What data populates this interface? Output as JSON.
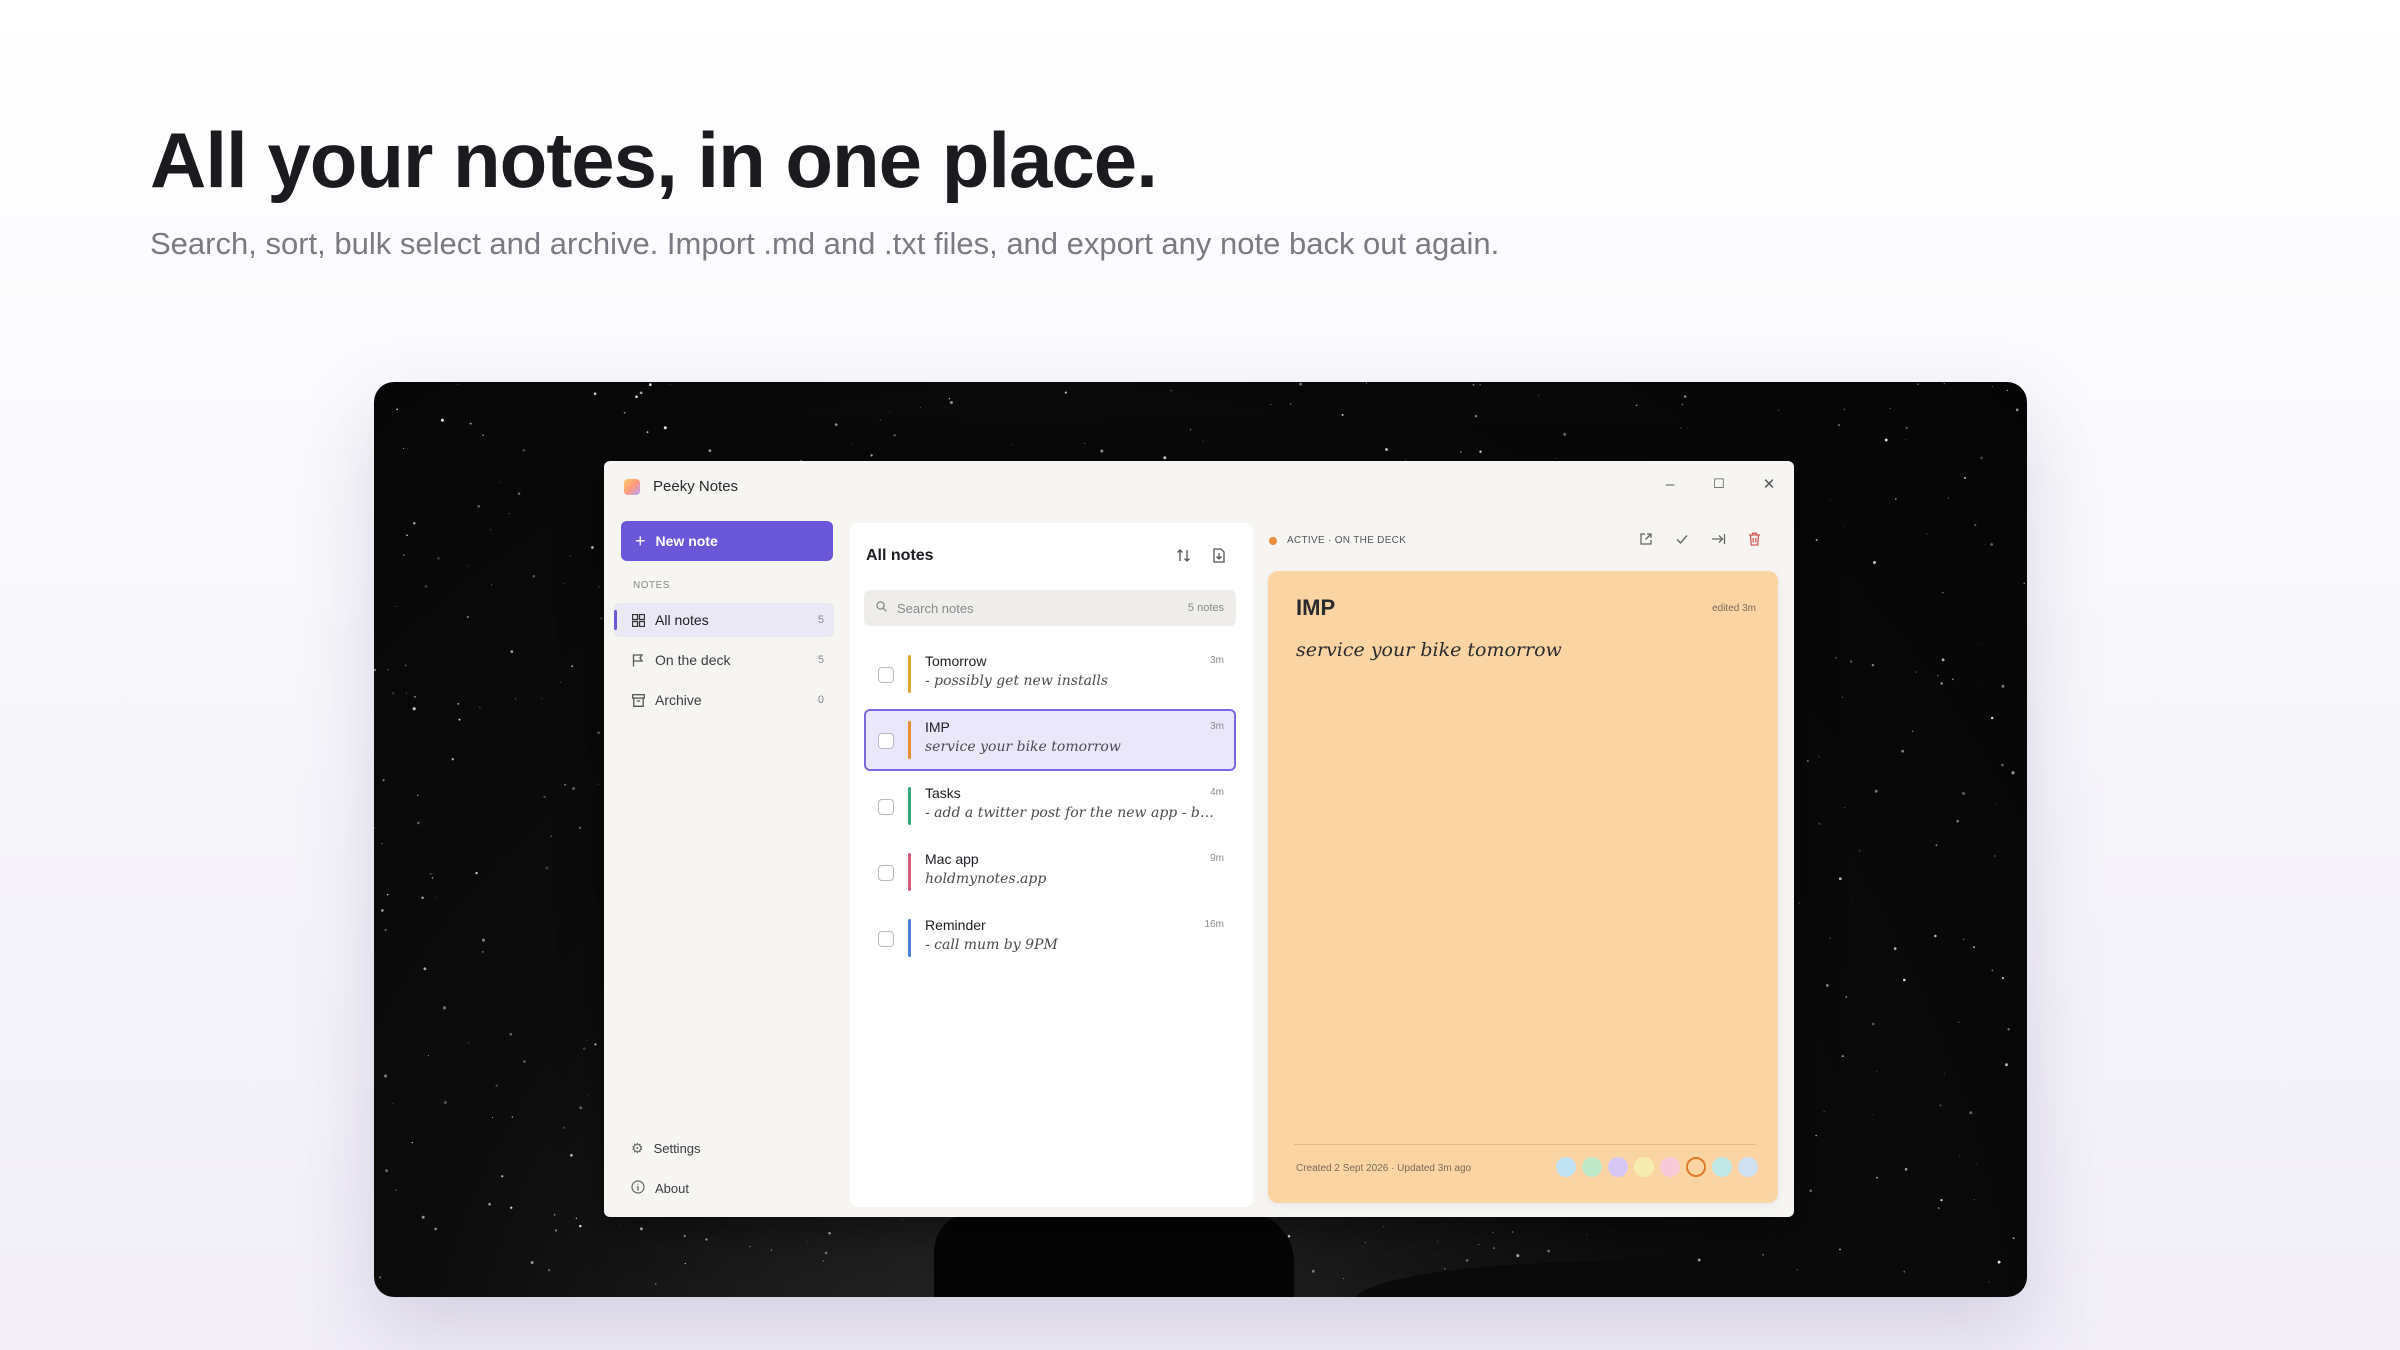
{
  "hero": {
    "title": "All your notes, in one place.",
    "subtitle": "Search, sort, bulk select and archive. Import .md and .txt files, and export any note back out again."
  },
  "app": {
    "title": "Peeky Notes",
    "window_controls": {
      "minimize": "–",
      "maximize": "☐",
      "close": "✕"
    }
  },
  "sidebar": {
    "new_note_label": "New note",
    "section_label": "NOTES",
    "items": [
      {
        "label": "All notes",
        "count": "5",
        "icon": "grid-icon"
      },
      {
        "label": "On the deck",
        "count": "5",
        "icon": "flag-icon"
      },
      {
        "label": "Archive",
        "count": "0",
        "icon": "archive-icon"
      }
    ],
    "footer": [
      {
        "label": "Settings",
        "icon": "gear-icon"
      },
      {
        "label": "About",
        "icon": "info-icon"
      }
    ]
  },
  "list": {
    "title": "All notes",
    "search_placeholder": "Search notes",
    "search_count": "5 notes",
    "notes": [
      {
        "title": "Tomorrow",
        "preview": "- possibly get new installs",
        "time": "3m",
        "color": "#e0a92e"
      },
      {
        "title": "IMP",
        "preview": "service your bike tomorrow",
        "time": "3m",
        "color": "#e98b3a"
      },
      {
        "title": "Tasks",
        "preview": "- add a twitter post for the new app - bu...",
        "time": "4m",
        "color": "#3aa57a"
      },
      {
        "title": "Mac app",
        "preview": "holdmynotes.app",
        "time": "9m",
        "color": "#d45a78"
      },
      {
        "title": "Reminder",
        "preview": "- call mum by 9PM",
        "time": "16m",
        "color": "#4a7fd4"
      }
    ]
  },
  "detail": {
    "status": "ACTIVE · ON THE DECK",
    "status_color": "#e98b3a",
    "card_color": "#fbd4a4",
    "title": "IMP",
    "edited": "edited 3m",
    "body": "service your bike tomorrow",
    "meta": "Created 2 Sept 2026 · Updated 3m ago",
    "swatches": [
      "#bfe3f2",
      "#bfe8c8",
      "#d6c8f5",
      "#f6ecb0",
      "#f8c9d8",
      "selected",
      "#bfe8e6",
      "#cfe0f0"
    ]
  }
}
